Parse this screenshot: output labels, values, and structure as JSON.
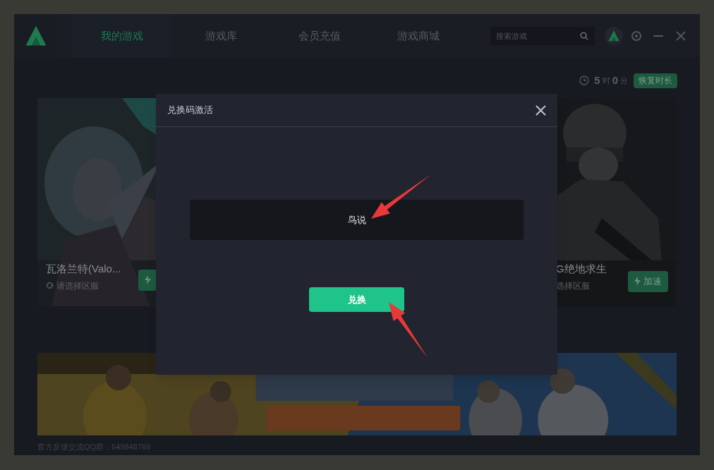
{
  "app": {
    "tabs": [
      {
        "label": "我的游戏",
        "selected": true
      },
      {
        "label": "游戏库",
        "selected": false
      },
      {
        "label": "会员充值",
        "selected": false
      },
      {
        "label": "游戏商城",
        "selected": false
      }
    ],
    "search": {
      "placeholder": "搜索游戏"
    },
    "time": {
      "hours": "5",
      "hours_unit": "时",
      "minutes": "0",
      "minutes_unit": "分",
      "restore_button": "恢复时长"
    },
    "games": [
      {
        "title": "瓦洛兰特(Valo...",
        "server": "请选择区服"
      },
      {
        "title": "G绝地求生",
        "server": "选择区服",
        "button": "加速"
      }
    ],
    "footer": "官方反馈交流QQ群：649848769"
  },
  "dialog": {
    "title": "兑换码激活",
    "code_field": {
      "value": "鸟说"
    },
    "submit_button": "兑换"
  }
}
